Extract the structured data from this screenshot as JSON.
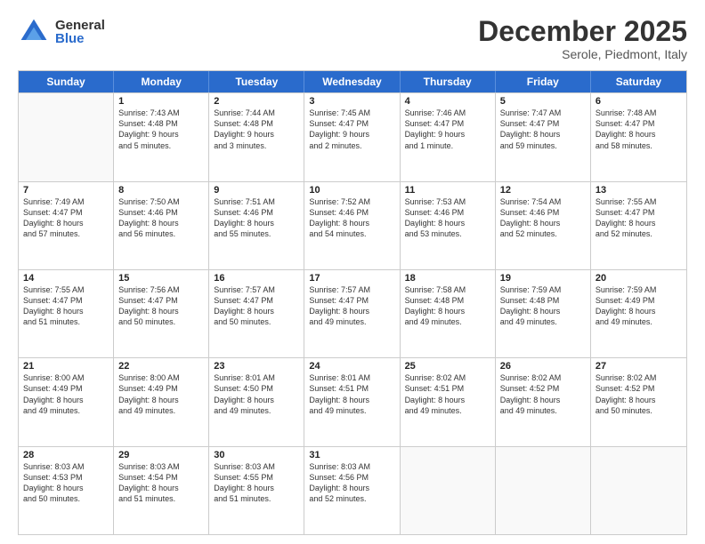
{
  "logo": {
    "general": "General",
    "blue": "Blue"
  },
  "header": {
    "month": "December 2025",
    "location": "Serole, Piedmont, Italy"
  },
  "days": [
    "Sunday",
    "Monday",
    "Tuesday",
    "Wednesday",
    "Thursday",
    "Friday",
    "Saturday"
  ],
  "rows": [
    [
      {
        "day": "",
        "lines": []
      },
      {
        "day": "1",
        "lines": [
          "Sunrise: 7:43 AM",
          "Sunset: 4:48 PM",
          "Daylight: 9 hours",
          "and 5 minutes."
        ]
      },
      {
        "day": "2",
        "lines": [
          "Sunrise: 7:44 AM",
          "Sunset: 4:48 PM",
          "Daylight: 9 hours",
          "and 3 minutes."
        ]
      },
      {
        "day": "3",
        "lines": [
          "Sunrise: 7:45 AM",
          "Sunset: 4:47 PM",
          "Daylight: 9 hours",
          "and 2 minutes."
        ]
      },
      {
        "day": "4",
        "lines": [
          "Sunrise: 7:46 AM",
          "Sunset: 4:47 PM",
          "Daylight: 9 hours",
          "and 1 minute."
        ]
      },
      {
        "day": "5",
        "lines": [
          "Sunrise: 7:47 AM",
          "Sunset: 4:47 PM",
          "Daylight: 8 hours",
          "and 59 minutes."
        ]
      },
      {
        "day": "6",
        "lines": [
          "Sunrise: 7:48 AM",
          "Sunset: 4:47 PM",
          "Daylight: 8 hours",
          "and 58 minutes."
        ]
      }
    ],
    [
      {
        "day": "7",
        "lines": [
          "Sunrise: 7:49 AM",
          "Sunset: 4:47 PM",
          "Daylight: 8 hours",
          "and 57 minutes."
        ]
      },
      {
        "day": "8",
        "lines": [
          "Sunrise: 7:50 AM",
          "Sunset: 4:46 PM",
          "Daylight: 8 hours",
          "and 56 minutes."
        ]
      },
      {
        "day": "9",
        "lines": [
          "Sunrise: 7:51 AM",
          "Sunset: 4:46 PM",
          "Daylight: 8 hours",
          "and 55 minutes."
        ]
      },
      {
        "day": "10",
        "lines": [
          "Sunrise: 7:52 AM",
          "Sunset: 4:46 PM",
          "Daylight: 8 hours",
          "and 54 minutes."
        ]
      },
      {
        "day": "11",
        "lines": [
          "Sunrise: 7:53 AM",
          "Sunset: 4:46 PM",
          "Daylight: 8 hours",
          "and 53 minutes."
        ]
      },
      {
        "day": "12",
        "lines": [
          "Sunrise: 7:54 AM",
          "Sunset: 4:46 PM",
          "Daylight: 8 hours",
          "and 52 minutes."
        ]
      },
      {
        "day": "13",
        "lines": [
          "Sunrise: 7:55 AM",
          "Sunset: 4:47 PM",
          "Daylight: 8 hours",
          "and 52 minutes."
        ]
      }
    ],
    [
      {
        "day": "14",
        "lines": [
          "Sunrise: 7:55 AM",
          "Sunset: 4:47 PM",
          "Daylight: 8 hours",
          "and 51 minutes."
        ]
      },
      {
        "day": "15",
        "lines": [
          "Sunrise: 7:56 AM",
          "Sunset: 4:47 PM",
          "Daylight: 8 hours",
          "and 50 minutes."
        ]
      },
      {
        "day": "16",
        "lines": [
          "Sunrise: 7:57 AM",
          "Sunset: 4:47 PM",
          "Daylight: 8 hours",
          "and 50 minutes."
        ]
      },
      {
        "day": "17",
        "lines": [
          "Sunrise: 7:57 AM",
          "Sunset: 4:47 PM",
          "Daylight: 8 hours",
          "and 49 minutes."
        ]
      },
      {
        "day": "18",
        "lines": [
          "Sunrise: 7:58 AM",
          "Sunset: 4:48 PM",
          "Daylight: 8 hours",
          "and 49 minutes."
        ]
      },
      {
        "day": "19",
        "lines": [
          "Sunrise: 7:59 AM",
          "Sunset: 4:48 PM",
          "Daylight: 8 hours",
          "and 49 minutes."
        ]
      },
      {
        "day": "20",
        "lines": [
          "Sunrise: 7:59 AM",
          "Sunset: 4:49 PM",
          "Daylight: 8 hours",
          "and 49 minutes."
        ]
      }
    ],
    [
      {
        "day": "21",
        "lines": [
          "Sunrise: 8:00 AM",
          "Sunset: 4:49 PM",
          "Daylight: 8 hours",
          "and 49 minutes."
        ]
      },
      {
        "day": "22",
        "lines": [
          "Sunrise: 8:00 AM",
          "Sunset: 4:49 PM",
          "Daylight: 8 hours",
          "and 49 minutes."
        ]
      },
      {
        "day": "23",
        "lines": [
          "Sunrise: 8:01 AM",
          "Sunset: 4:50 PM",
          "Daylight: 8 hours",
          "and 49 minutes."
        ]
      },
      {
        "day": "24",
        "lines": [
          "Sunrise: 8:01 AM",
          "Sunset: 4:51 PM",
          "Daylight: 8 hours",
          "and 49 minutes."
        ]
      },
      {
        "day": "25",
        "lines": [
          "Sunrise: 8:02 AM",
          "Sunset: 4:51 PM",
          "Daylight: 8 hours",
          "and 49 minutes."
        ]
      },
      {
        "day": "26",
        "lines": [
          "Sunrise: 8:02 AM",
          "Sunset: 4:52 PM",
          "Daylight: 8 hours",
          "and 49 minutes."
        ]
      },
      {
        "day": "27",
        "lines": [
          "Sunrise: 8:02 AM",
          "Sunset: 4:52 PM",
          "Daylight: 8 hours",
          "and 50 minutes."
        ]
      }
    ],
    [
      {
        "day": "28",
        "lines": [
          "Sunrise: 8:03 AM",
          "Sunset: 4:53 PM",
          "Daylight: 8 hours",
          "and 50 minutes."
        ]
      },
      {
        "day": "29",
        "lines": [
          "Sunrise: 8:03 AM",
          "Sunset: 4:54 PM",
          "Daylight: 8 hours",
          "and 51 minutes."
        ]
      },
      {
        "day": "30",
        "lines": [
          "Sunrise: 8:03 AM",
          "Sunset: 4:55 PM",
          "Daylight: 8 hours",
          "and 51 minutes."
        ]
      },
      {
        "day": "31",
        "lines": [
          "Sunrise: 8:03 AM",
          "Sunset: 4:56 PM",
          "Daylight: 8 hours",
          "and 52 minutes."
        ]
      },
      {
        "day": "",
        "lines": []
      },
      {
        "day": "",
        "lines": []
      },
      {
        "day": "",
        "lines": []
      }
    ]
  ]
}
